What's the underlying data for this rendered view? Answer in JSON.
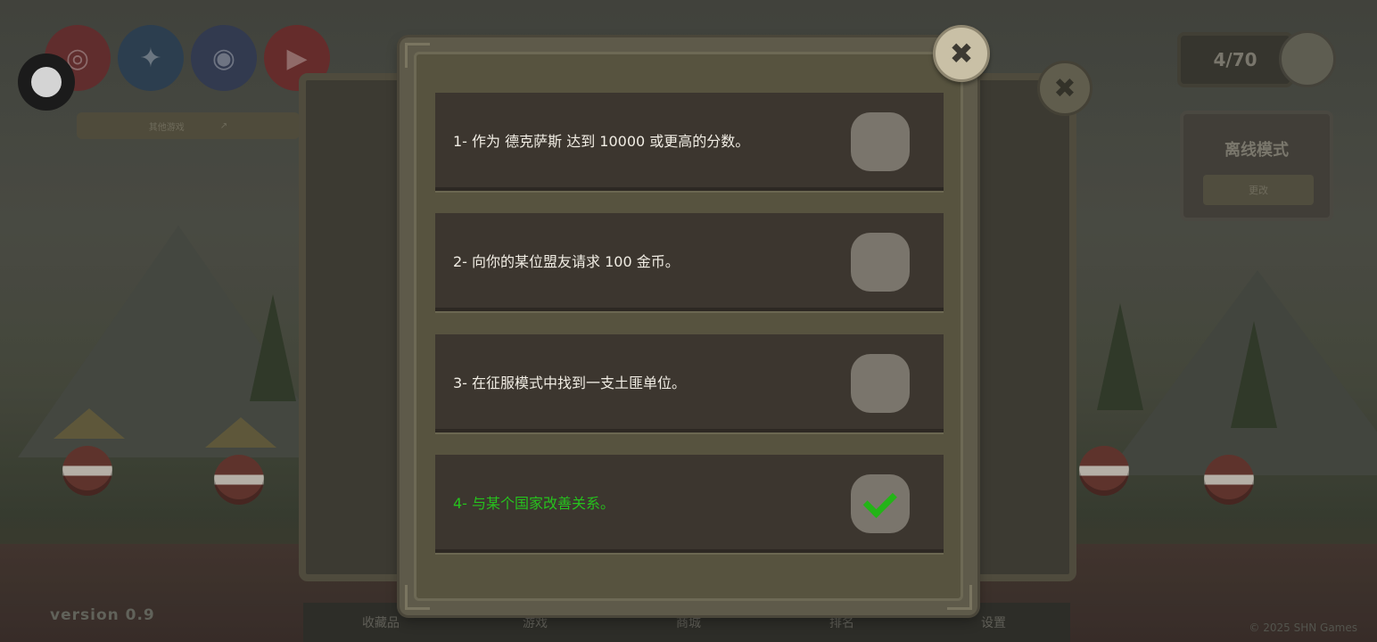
{
  "background": {
    "version_label": "version 0.9",
    "copyright": "© 2025 SHN Games",
    "other_games_label": "其他游戏",
    "social": [
      {
        "name": "instagram-icon",
        "glyph": "◎",
        "color": "#7a3a3a"
      },
      {
        "name": "twitter-icon",
        "glyph": "✦",
        "color": "#34495a"
      },
      {
        "name": "discord-icon",
        "glyph": "◉",
        "color": "#3c4560"
      },
      {
        "name": "youtube-icon",
        "glyph": "▶",
        "color": "#7a3632"
      }
    ],
    "counter": "4/70",
    "offline_mode_title": "离线模式",
    "offline_mode_button": "更改",
    "bottom_nav": [
      "收藏品",
      "游戏",
      "商城",
      "排名",
      "设置"
    ]
  },
  "modal": {
    "close_glyph": "✖",
    "tasks": [
      {
        "text": "1- 作为 德克萨斯 达到 10000 或更高的分数。",
        "completed": false
      },
      {
        "text": "2- 向你的某位盟友请求 100 金币。",
        "completed": false
      },
      {
        "text": "3- 在征服模式中找到一支土匪单位。",
        "completed": false
      },
      {
        "text": "4- 与某个国家改善关系。",
        "completed": true
      }
    ]
  },
  "colors": {
    "completed_text": "#26c21d",
    "task_text": "#f1ede4",
    "panel_bg": "#3c362f"
  }
}
